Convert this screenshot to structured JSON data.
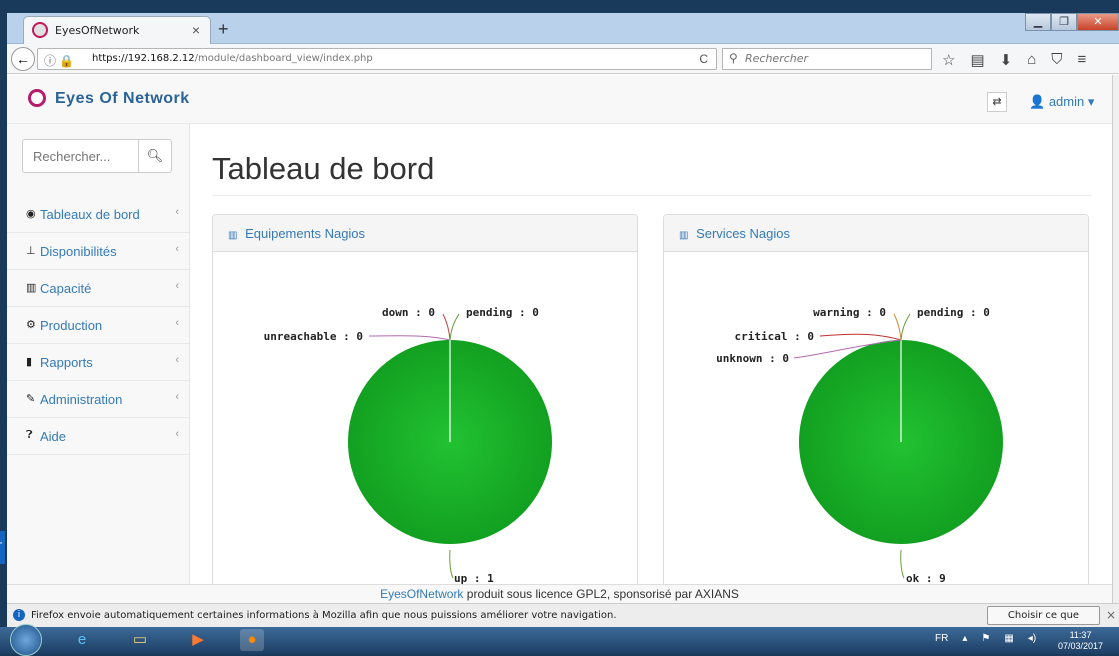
{
  "browser": {
    "tab_title": "EyesOfNetwork",
    "tab_close": "×",
    "new_tab": "+",
    "url_host": "https://192.168.2.12",
    "url_path": "/module/dashboard_view/index.php",
    "search_placeholder": "Rechercher"
  },
  "app": {
    "logo_text": "Eyes Of Network",
    "user": "admin ▾"
  },
  "sidebar": {
    "search_placeholder": "Rechercher...",
    "items": [
      {
        "label": "Tableaux de bord",
        "icon": "dashboard-icon"
      },
      {
        "label": "Disponibilités",
        "icon": "sitemap-icon"
      },
      {
        "label": "Capacité",
        "icon": "bar-chart-icon"
      },
      {
        "label": "Production",
        "icon": "cogs-icon"
      },
      {
        "label": "Rapports",
        "icon": "book-icon"
      },
      {
        "label": "Administration",
        "icon": "wrench-icon"
      },
      {
        "label": "Aide",
        "icon": "question-icon"
      }
    ],
    "edge_tag": "T"
  },
  "main": {
    "title": "Tableau de bord",
    "panels": [
      {
        "title": "Equipements Nagios"
      },
      {
        "title": "Services Nagios"
      }
    ]
  },
  "chart_data": [
    {
      "type": "pie",
      "title": "Equipements Nagios",
      "categories": [
        "up",
        "down",
        "unreachable",
        "pending"
      ],
      "values": [
        1,
        0,
        0,
        0
      ],
      "labels": [
        "up : 1",
        "down : 0",
        "unreachable : 0",
        "pending : 0"
      ],
      "colors": {
        "up": "#1db32a"
      }
    },
    {
      "type": "pie",
      "title": "Services Nagios",
      "categories": [
        "ok",
        "warning",
        "critical",
        "unknown",
        "pending"
      ],
      "values": [
        9,
        0,
        0,
        0,
        0
      ],
      "labels": [
        "ok : 9",
        "warning : 0",
        "critical : 0",
        "unknown : 0",
        "pending : 0"
      ],
      "colors": {
        "ok": "#1db32a"
      }
    }
  ],
  "footer": {
    "link": "EyesOfNetwork",
    "text": " produit sous licence GPL2, sponsorisé par AXIANS"
  },
  "notification": {
    "text": "Firefox envoie automatiquement certaines informations à Mozilla afin que nous puissions améliorer votre navigation.",
    "button": "Choisir ce que j'envoie",
    "close": "×"
  },
  "taskbar": {
    "lang": "FR",
    "time": "11:37",
    "date": "07/03/2017"
  }
}
